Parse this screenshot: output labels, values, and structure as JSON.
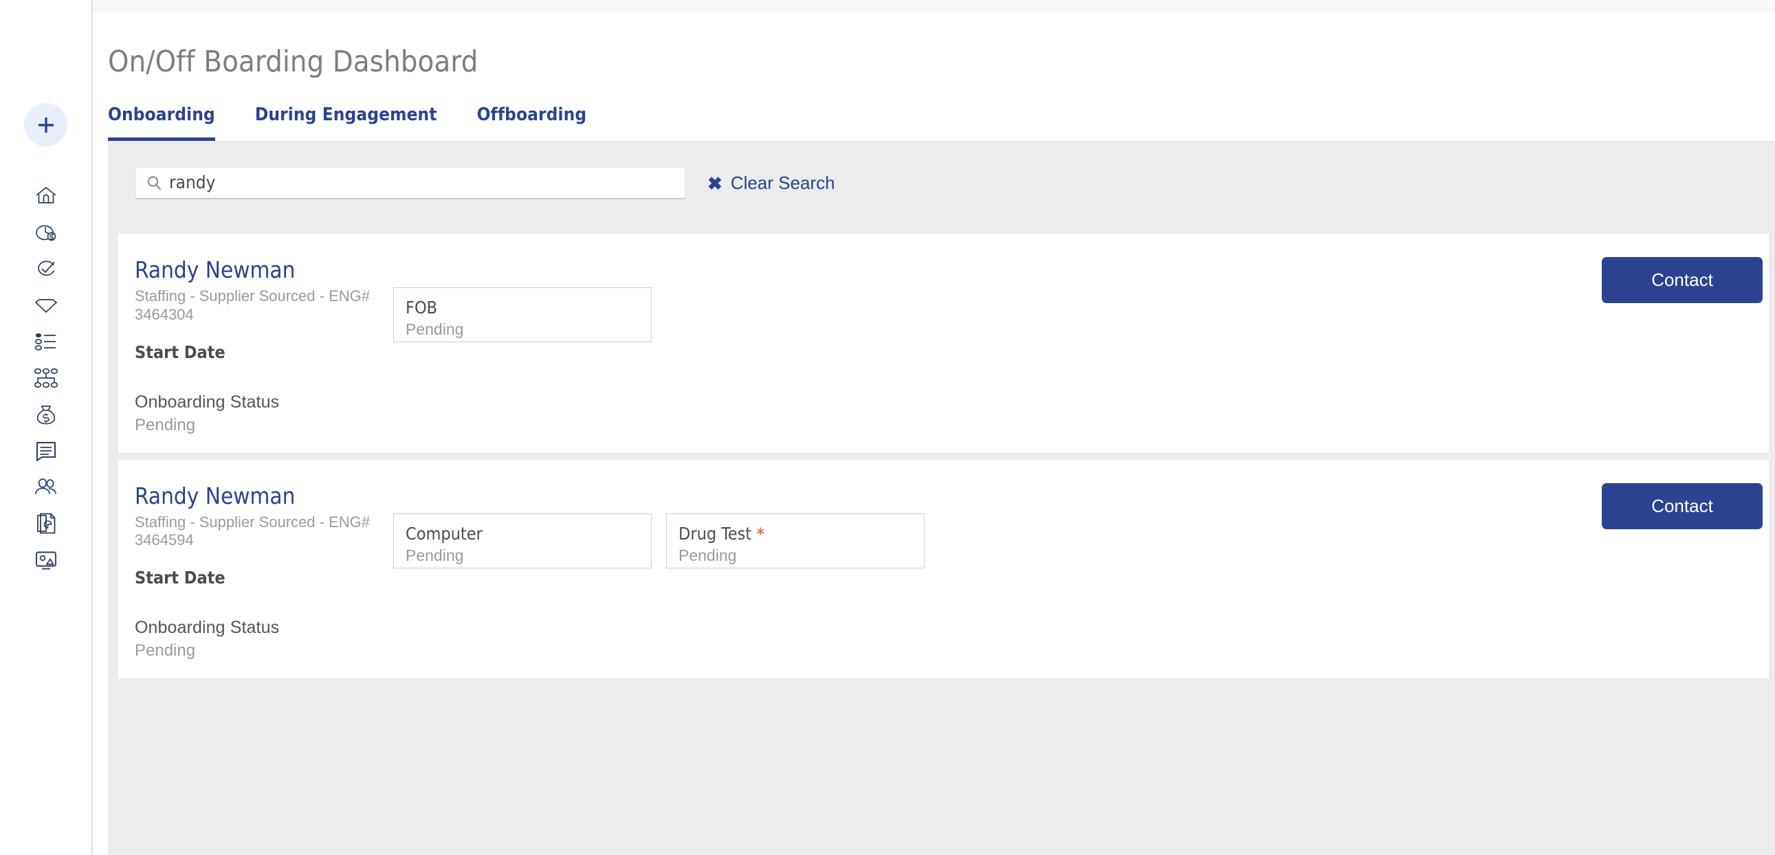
{
  "sidebar": {
    "add_button": {
      "name": "add-button",
      "icon": "plus-icon"
    },
    "items": [
      {
        "icon": "home-icon",
        "name": "nav-home"
      },
      {
        "icon": "clock-dollar-icon",
        "name": "nav-timesheets"
      },
      {
        "icon": "check-circle-icon",
        "name": "nav-approvals"
      },
      {
        "icon": "diamond-icon",
        "name": "nav-diamond"
      },
      {
        "icon": "list-icon",
        "name": "nav-list"
      },
      {
        "icon": "org-chart-icon",
        "name": "nav-org-chart"
      },
      {
        "icon": "money-bag-icon",
        "name": "nav-budget"
      },
      {
        "icon": "document-icon",
        "name": "nav-documents"
      },
      {
        "icon": "users-icon",
        "name": "nav-people"
      },
      {
        "icon": "report-pie-icon",
        "name": "nav-reports"
      },
      {
        "icon": "image-monitor-icon",
        "name": "nav-media"
      }
    ]
  },
  "header": {
    "title": "On/Off Boarding Dashboard"
  },
  "tabs": [
    {
      "label": "Onboarding",
      "active": true
    },
    {
      "label": "During Engagement",
      "active": false
    },
    {
      "label": "Offboarding",
      "active": false
    }
  ],
  "search": {
    "value": "randy",
    "placeholder": "",
    "icon": "search-icon",
    "clear_label": "Clear Search",
    "clear_icon": "close-x-icon"
  },
  "colors": {
    "accent_navy": "#2b4390",
    "panel_gray": "#ececec",
    "required_red": "#e8705f",
    "muted_text": "#9a9a9a"
  },
  "labels": {
    "start_date": "Start Date",
    "onboarding_status": "Onboarding Status",
    "contact": "Contact"
  },
  "cards": [
    {
      "name": "Randy Newman",
      "subtitle": "Staffing - Supplier Sourced - ENG# 3464304",
      "start_date_label": "Start Date",
      "start_date_value": "",
      "onboarding_status_label": "Onboarding Status",
      "onboarding_status_value": "Pending",
      "contact_label": "Contact",
      "tiles": [
        {
          "title": "FOB",
          "required": false,
          "status": "Pending"
        }
      ]
    },
    {
      "name": "Randy Newman",
      "subtitle": "Staffing - Supplier Sourced - ENG# 3464594",
      "start_date_label": "Start Date",
      "start_date_value": "",
      "onboarding_status_label": "Onboarding Status",
      "onboarding_status_value": "Pending",
      "contact_label": "Contact",
      "tiles": [
        {
          "title": "Computer",
          "required": false,
          "status": "Pending"
        },
        {
          "title": "Drug Test",
          "required": true,
          "status": "Pending"
        }
      ]
    }
  ]
}
